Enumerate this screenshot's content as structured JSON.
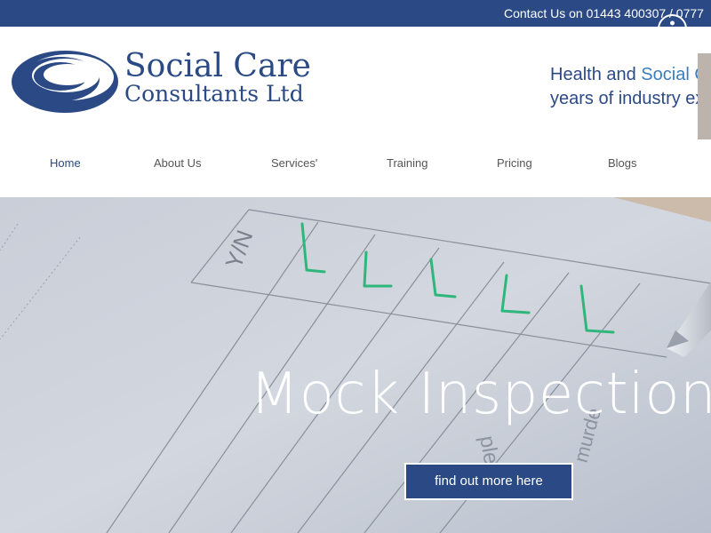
{
  "topbar": {
    "contact_text": "Contact Us on 01443 400307 / 0777"
  },
  "logo": {
    "line1": "Social Care",
    "line2": "Consultants Ltd"
  },
  "tagline": {
    "line1_a": "Health and ",
    "line1_b": "Social C",
    "line2": "years of industry exp"
  },
  "nav": {
    "items": [
      {
        "label": "Home",
        "active": true
      },
      {
        "label": "About Us"
      },
      {
        "label": "Services'"
      },
      {
        "label": "Training"
      },
      {
        "label": "Pricing"
      },
      {
        "label": "Blogs"
      }
    ]
  },
  "hero": {
    "title": "Mock Inspections",
    "cta_label": "find out more here",
    "form_text": {
      "yn_label": "Y/N",
      "word_please": "please",
      "word_murde": "murde"
    }
  },
  "colors": {
    "brand_blue": "#2b4a85",
    "accent_blue": "#3a7ec1",
    "check_green": "#2fb67a"
  }
}
